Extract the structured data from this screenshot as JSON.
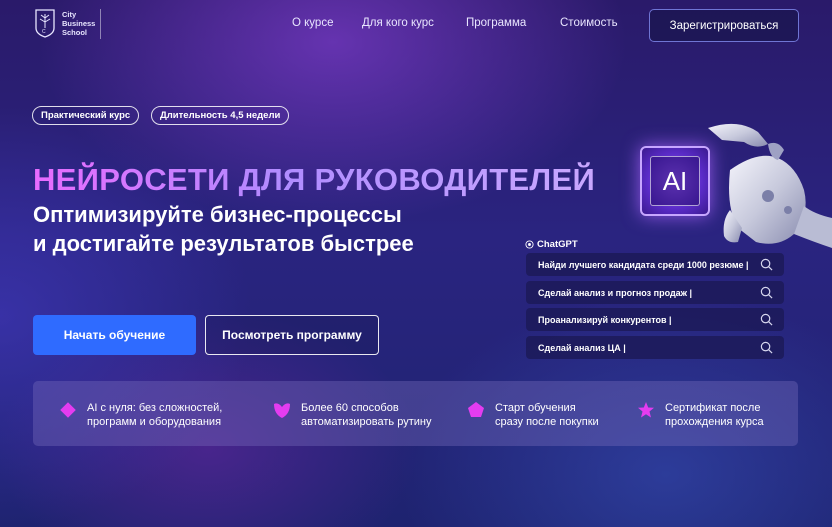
{
  "header": {
    "logo_text": "City\nBusiness\nSchool",
    "nav": [
      "О курсе",
      "Для кого курс",
      "Программа",
      "Стоимость"
    ],
    "register_label": "Зарегистрироваться"
  },
  "tags": [
    "Практический курс",
    "Длительность 4,5 недели"
  ],
  "hero": {
    "title": "НЕЙРОСЕТИ ДЛЯ РУКОВОДИТЕЛЕЙ",
    "subtitle_line1": "Оптимизируйте бизнес-процессы",
    "subtitle_line2": "и достигайте результатов быстрее"
  },
  "buttons": {
    "start_label": "Начать обучение",
    "program_label": "Посмотреть программу"
  },
  "chip_label": "AI",
  "chat": {
    "label": "ChatGPT",
    "prompts": [
      "Найди лучшего кандидата среди 1000 резюме |",
      "Сделай анализ и прогноз продаж |",
      "Проанализируй конкурентов |",
      "Сделай  анализ ЦА |"
    ]
  },
  "features": [
    {
      "icon": "diamond-icon",
      "text": "AI с нуля: без сложностей,\nпрограмм и оборудования"
    },
    {
      "icon": "heart-shape-icon",
      "text": "Более 60 способов\nавтоматизировать рутину"
    },
    {
      "icon": "pentagon-icon",
      "text": "Старт обучения\nсразу после покупки"
    },
    {
      "icon": "star-icon",
      "text": "Сертификат после\nпрохождения курса"
    }
  ],
  "colors": {
    "accent_blue": "#2f6bff",
    "accent_pink": "#e43cf0",
    "title_gradient_start": "#e86bff"
  }
}
